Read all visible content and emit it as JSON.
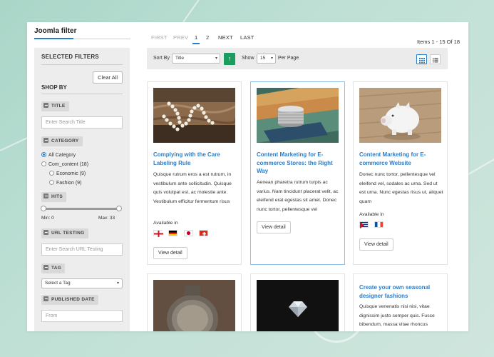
{
  "module": {
    "title": "Joomla filter"
  },
  "sidebar": {
    "selected_filters": "SELECTED FILTERS",
    "clear_all": "Clear All",
    "shop_by": "SHOP BY",
    "title": {
      "label": "TITLE",
      "placeholder": "Enter Search Title"
    },
    "category": {
      "label": "CATEGORY",
      "options": [
        "All Category",
        "Com_content (18)",
        "Economic (9)",
        "Fashion (9)"
      ],
      "selected": "All Category"
    },
    "hits": {
      "label": "HITS",
      "min_text": "Min: 0",
      "max_text": "Max: 33",
      "min": 0,
      "max": 33
    },
    "url_testing": {
      "label": "URL TESTING",
      "placeholder": "Enter Search URL Testing"
    },
    "tag": {
      "label": "TAG",
      "selected": "Select a Tag"
    },
    "published_date": {
      "label": "PUBLISHED DATE",
      "placeholder": "From"
    }
  },
  "pagination": {
    "first": "FIRST",
    "prev": "PREV",
    "pages": [
      "1",
      "2"
    ],
    "current": "1",
    "next": "NEXT",
    "last": "LAST",
    "items_text": "Items  1 - 15  Of  18"
  },
  "toolbar": {
    "sort_by_label": "Sort By",
    "sort_by_value": "Title",
    "show_label": "Show",
    "show_value": "15",
    "per_page_label": "Per Page",
    "view_mode": "grid"
  },
  "products": [
    {
      "title": "Complying with the Care Labeling Rule",
      "description": "Quisque rutrum eros a est rutrum, in vestibulum ante sollicitudin. Quisque quis volutpat est, ac molestie ante. Vestibulum efficitur fermentum risus",
      "available_label": "Available in",
      "flags": [
        "england",
        "germany",
        "japan",
        "switzerland"
      ],
      "button": "View detail"
    },
    {
      "title": "Content Marketing for E-commerce Stores: the Right Way",
      "description": "Aenean pharetra rutrum turpis ac varius. Nam tincidunt placerat velit, ac eleifend erat egestas sit amet. Donec nunc tortor, pellentesque vel",
      "button": "View detail"
    },
    {
      "title": "Content Marketing for E-commerce Website",
      "description": "Donec nunc tortor, pellentesque vel eleifend vel, sodales ac urna. Sed ut est urna. Nunc egestas risus ut, aliquet quam",
      "available_label": "Available in",
      "flags": [
        "cuba",
        "france"
      ],
      "button": "View detail"
    },
    {
      "title": "",
      "description": ""
    },
    {
      "title": "",
      "description": ""
    },
    {
      "title": "Create your own seasonal designer fashions",
      "description": "Quisque venenatis nisi nisi, vitae dignissim justo semper quis. Fusce bibendum, massa vitae rhoncus"
    }
  ],
  "colors": {
    "accent": "#2a7dc9",
    "sort_button": "#1a9d5f"
  }
}
